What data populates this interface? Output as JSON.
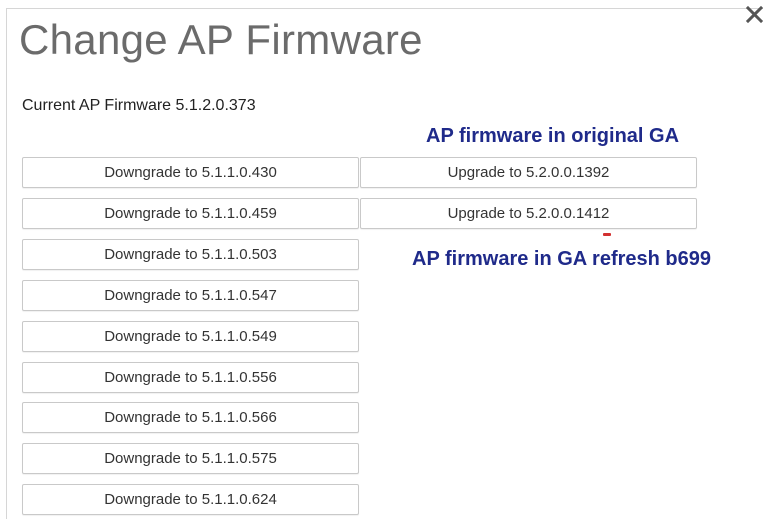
{
  "dialog": {
    "title": "Change AP Firmware",
    "current_firmware": "Current AP Firmware 5.1.2.0.373"
  },
  "downgrade_buttons": [
    "Downgrade to 5.1.1.0.430",
    "Downgrade to 5.1.1.0.459",
    "Downgrade to 5.1.1.0.503",
    "Downgrade to 5.1.1.0.547",
    "Downgrade to 5.1.1.0.549",
    "Downgrade to 5.1.1.0.556",
    "Downgrade to 5.1.1.0.566",
    "Downgrade to 5.1.1.0.575",
    "Downgrade to 5.1.1.0.624"
  ],
  "upgrade_buttons": [
    "Upgrade to 5.2.0.0.1392",
    "Upgrade to 5.2.0.0.1412"
  ],
  "annotations": {
    "original_ga": "AP firmware in original GA",
    "ga_refresh": "AP firmware in GA refresh b699"
  },
  "colors": {
    "annotation_text": "#1f2a8a",
    "title_text": "#6b6b6b"
  },
  "icons": {
    "close": "close-icon"
  }
}
